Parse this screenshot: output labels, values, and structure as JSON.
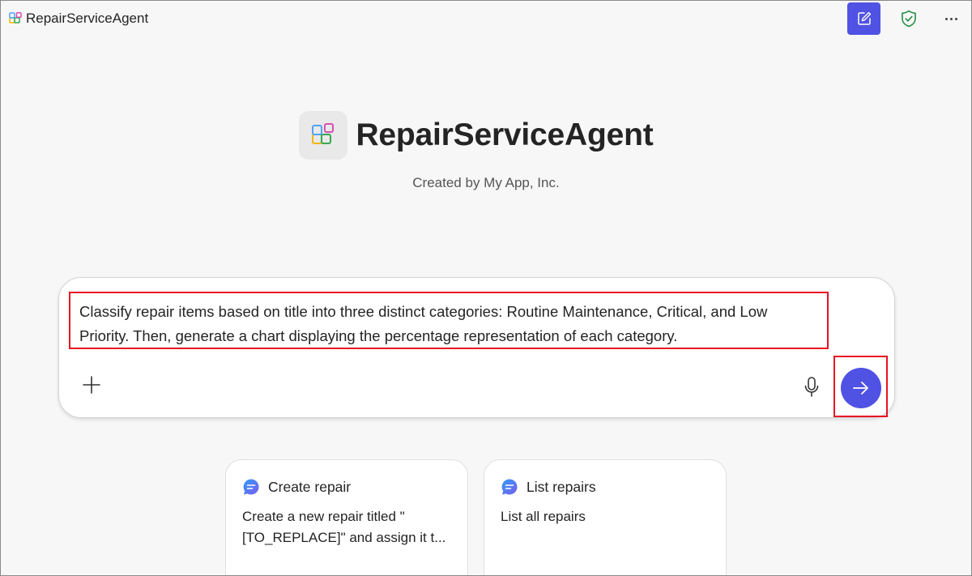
{
  "window": {
    "app_title": "RepairServiceAgent",
    "icons": {
      "app": "app-grid-icon",
      "new_chat": "compose-icon",
      "shield": "shield-check-icon",
      "more": "more-horizontal-icon"
    }
  },
  "hero": {
    "title": "RepairServiceAgent",
    "subtitle": "Created by My App, Inc."
  },
  "composer": {
    "prompt_text": "Classify repair items based on title into three distinct categories: Routine Maintenance, Critical, and Low Priority. Then, generate a chart displaying the percentage representation of each category.",
    "icons": {
      "attach": "plus-icon",
      "mic": "microphone-icon",
      "send": "arrow-right-icon"
    },
    "highlight_color": "#e81123",
    "accent_color": "#4f52e3"
  },
  "suggestions": [
    {
      "title": "Create repair",
      "description": "Create a new repair titled \"[TO_REPLACE]\" and assign it t...",
      "icon": "chat-bubble-icon"
    },
    {
      "title": "List repairs",
      "description": "List all repairs",
      "icon": "chat-bubble-icon"
    }
  ]
}
